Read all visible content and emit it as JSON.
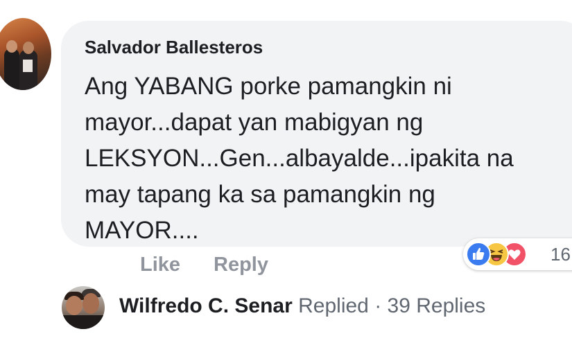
{
  "comment": {
    "author": "Salvador Ballesteros",
    "text_lines": [
      "Ang YABANG porke pamangkin ni",
      "mayor...dapat yan mabigyan ng",
      "LEKSYON...Gen...albayalde...ipakita na",
      "may tapang ka sa pamangkin ng",
      "MAYOR...."
    ],
    "avatar_icon": "profile-photo-avatar"
  },
  "actions": {
    "like_label": "Like",
    "reply_label": "Reply"
  },
  "reactions": {
    "icons": [
      "like-icon",
      "haha-icon",
      "love-icon"
    ],
    "count": "16"
  },
  "reply_summary": {
    "author": "Wilfredo C. Senar",
    "verb": "Replied",
    "separator": " · ",
    "replies_count": "39 Replies"
  },
  "colors": {
    "bubble": "#f2f3f5",
    "text": "#1c1e21",
    "muted": "#90949c",
    "like_blue": "#3b7bf0",
    "haha_yellow": "#f7c642",
    "love_red": "#f25268"
  }
}
